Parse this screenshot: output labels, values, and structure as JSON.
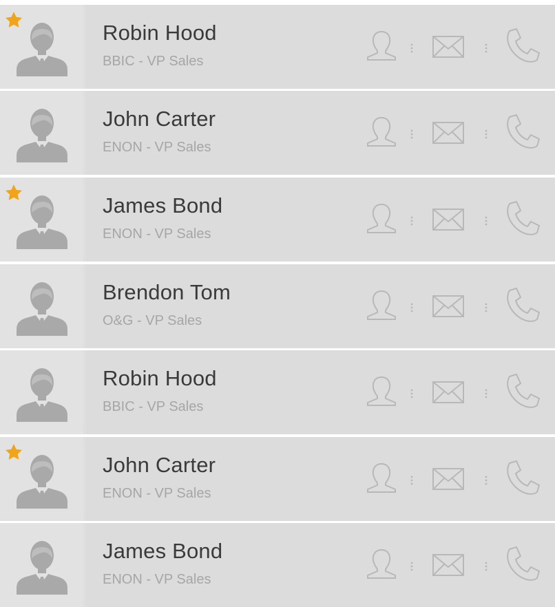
{
  "colors": {
    "star": "#f0a419",
    "icon_gray": "#b8b8b8",
    "avatar_gray": "#a9a9a9",
    "row_bg": "#dcdcdc"
  },
  "contacts": [
    {
      "name": "Robin Hood",
      "subtitle": "BBIC - VP Sales",
      "starred": true
    },
    {
      "name": "John Carter",
      "subtitle": "ENON - VP Sales",
      "starred": false
    },
    {
      "name": "James Bond",
      "subtitle": "ENON - VP Sales",
      "starred": true
    },
    {
      "name": "Brendon Tom",
      "subtitle": "O&G - VP Sales",
      "starred": false
    },
    {
      "name": "Robin Hood",
      "subtitle": "BBIC - VP Sales",
      "starred": false
    },
    {
      "name": "John Carter",
      "subtitle": "ENON - VP Sales",
      "starred": true
    },
    {
      "name": "James Bond",
      "subtitle": "ENON - VP Sales",
      "starred": false
    }
  ],
  "icons": {
    "avatar": "person-avatar-icon",
    "star": "star-icon",
    "contact": "contact-profile-icon",
    "mail": "mail-envelope-icon",
    "phone": "phone-handset-icon"
  }
}
